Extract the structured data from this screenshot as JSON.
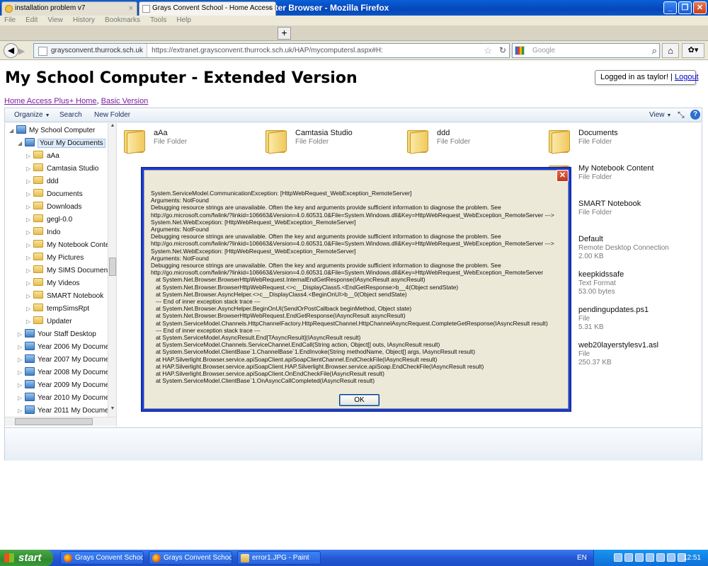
{
  "browser": {
    "title": "Grays Convent School - Home Access Plus+ - My School Computer Browser - Mozilla Firefox",
    "menu": [
      "File",
      "Edit",
      "View",
      "History",
      "Bookmarks",
      "Tools",
      "Help"
    ],
    "tabs": [
      {
        "label": "installation problem v7",
        "close": "×"
      },
      {
        "label": "Grays Convent School - Home Access Plu...",
        "close": "×"
      }
    ],
    "new_tab": "+",
    "site_identity": "graysconvent.thurrock.sch.uk",
    "url": "https://extranet.graysconvent.thurrock.sch.uk/HAP/mycomputersl.aspx#H:",
    "search_placeholder": "Google"
  },
  "page": {
    "title": "My School Computer - Extended Version",
    "login_prefix": "Logged in as taylor! |",
    "logout_label": "Logout",
    "link_home": "Home Access Plus+ Home",
    "link_sep": ",",
    "link_basic": "Basic Version"
  },
  "commandbar": {
    "organize": "Organize",
    "search": "Search",
    "new_folder": "New Folder",
    "view": "View"
  },
  "tree": [
    {
      "label": "My School Computer",
      "kind": "root",
      "exp": "◢"
    },
    {
      "label": "Your My Documents",
      "kind": "pc",
      "exp": "◢",
      "selected": true
    },
    {
      "label": "aAa",
      "kind": "folder",
      "exp": "▷"
    },
    {
      "label": "Camtasia Studio",
      "kind": "folder",
      "exp": "▷"
    },
    {
      "label": "ddd",
      "kind": "folder",
      "exp": "▷"
    },
    {
      "label": "Documents",
      "kind": "folder",
      "exp": "▷"
    },
    {
      "label": "Downloads",
      "kind": "folder",
      "exp": "▷"
    },
    {
      "label": "gegl-0.0",
      "kind": "folder",
      "exp": "▷"
    },
    {
      "label": "Indo",
      "kind": "folder",
      "exp": "▷"
    },
    {
      "label": "My Notebook Conte",
      "kind": "folder",
      "exp": "▷"
    },
    {
      "label": "My Pictures",
      "kind": "folder",
      "exp": "▷"
    },
    {
      "label": "My SIMS Document",
      "kind": "folder",
      "exp": "▷"
    },
    {
      "label": "My Videos",
      "kind": "folder",
      "exp": "▷"
    },
    {
      "label": "SMART Notebook",
      "kind": "folder",
      "exp": "▷"
    },
    {
      "label": "tempSimsRpt",
      "kind": "folder",
      "exp": "▷"
    },
    {
      "label": "Updater",
      "kind": "folder",
      "exp": "▷"
    },
    {
      "label": "Your Staff Desktop",
      "kind": "pc",
      "exp": "▷"
    },
    {
      "label": "Year 2006 My Docume",
      "kind": "pc",
      "exp": "▷"
    },
    {
      "label": "Year 2007 My Docume",
      "kind": "pc",
      "exp": "▷"
    },
    {
      "label": "Year 2008 My Docume",
      "kind": "pc",
      "exp": "▷"
    },
    {
      "label": "Year 2009 My Docume",
      "kind": "pc",
      "exp": "▷"
    },
    {
      "label": "Year 2010 My Docume",
      "kind": "pc",
      "exp": "▷"
    },
    {
      "label": "Year 2011 My Docume",
      "kind": "pc",
      "exp": "▷"
    }
  ],
  "files": [
    {
      "name": "aAa",
      "type": "File Folder",
      "size": ""
    },
    {
      "name": "Camtasia Studio",
      "type": "File Folder",
      "size": ""
    },
    {
      "name": "ddd",
      "type": "File Folder",
      "size": ""
    },
    {
      "name": "Documents",
      "type": "File Folder",
      "size": ""
    },
    {
      "name": "My Notebook Content",
      "type": "File Folder",
      "size": ""
    },
    {
      "name": "SMART Notebook",
      "type": "File Folder",
      "size": ""
    },
    {
      "name": "Default",
      "type": "Remote Desktop Connection",
      "size": "2.00 KB"
    },
    {
      "name": "keepkidssafe",
      "type": "Text Format",
      "size": "53.00 bytes"
    },
    {
      "name": "pendingupdates.ps1",
      "type": "File",
      "size": "5.31 KB"
    },
    {
      "name": "web20layerstylesv1.asl",
      "type": "File",
      "size": "250.37 KB"
    }
  ],
  "dialog": {
    "message": "System.ServiceModel.CommunicationException: [HttpWebRequest_WebException_RemoteServer]\nArguments: NotFound\nDebugging resource strings are unavailable. Often the key and arguments provide sufficient information to diagnose the problem. See\nhttp://go.microsoft.com/fwlink/?linkid=106663&Version=4.0.60531.0&File=System.Windows.dll&Key=HttpWebRequest_WebException_RemoteServer --->\nSystem.Net.WebException: [HttpWebRequest_WebException_RemoteServer]\nArguments: NotFound\nDebugging resource strings are unavailable. Often the key and arguments provide sufficient information to diagnose the problem. See\nhttp://go.microsoft.com/fwlink/?linkid=106663&Version=4.0.60531.0&File=System.Windows.dll&Key=HttpWebRequest_WebException_RemoteServer --->\nSystem.Net.WebException: [HttpWebRequest_WebException_RemoteServer]\nArguments: NotFound\nDebugging resource strings are unavailable. Often the key and arguments provide sufficient information to diagnose the problem. See\nhttp://go.microsoft.com/fwlink/?linkid=106663&Version=4.0.60531.0&File=System.Windows.dll&Key=HttpWebRequest_WebException_RemoteServer\n   at System.Net.Browser.BrowserHttpWebRequest.InternalEndGetResponse(IAsyncResult asyncResult)\n   at System.Net.Browser.BrowserHttpWebRequest.<>c__DisplayClass5.<EndGetResponse>b__4(Object sendState)\n   at System.Net.Browser.AsyncHelper.<>c__DisplayClass4.<BeginOnUI>b__0(Object sendState)\n   --- End of inner exception stack trace ---\n   at System.Net.Browser.AsyncHelper.BeginOnUI(SendOrPostCallback beginMethod, Object state)\n   at System.Net.Browser.BrowserHttpWebRequest.EndGetResponse(IAsyncResult asyncResult)\n   at System.ServiceModel.Channels.HttpChannelFactory.HttpRequestChannel.HttpChannelAsyncRequest.CompleteGetResponse(IAsyncResult result)\n   --- End of inner exception stack trace ---\n   at System.ServiceModel.AsyncResult.End[TAsyncResult](IAsyncResult result)\n   at System.ServiceModel.Channels.ServiceChannel.EndCall(String action, Object[] outs, IAsyncResult result)\n   at System.ServiceModel.ClientBase`1.ChannelBase`1.EndInvoke(String methodName, Object[] args, IAsyncResult result)\n   at HAP.Silverlight.Browser.service.apiSoapClient.apiSoapClientChannel.EndCheckFile(IAsyncResult result)\n   at HAP.Silverlight.Browser.service.apiSoapClient.HAP.Silverlight.Browser.service.apiSoap.EndCheckFile(IAsyncResult result)\n   at HAP.Silverlight.Browser.service.apiSoapClient.OnEndCheckFile(IAsyncResult result)\n   at System.ServiceModel.ClientBase`1.OnAsyncCallCompleted(IAsyncResult result)",
    "ok_label": "OK",
    "close_label": "✕"
  },
  "taskbar": {
    "start_label": "start",
    "items": [
      {
        "label": "Grays Convent Schoo...",
        "icon": "firefox-icon"
      },
      {
        "label": "Grays Convent Schoo...",
        "icon": "firefox-icon"
      },
      {
        "label": "error1.JPG - Paint",
        "icon": "paint-icon"
      }
    ],
    "language": "EN",
    "clock": "12:51"
  }
}
